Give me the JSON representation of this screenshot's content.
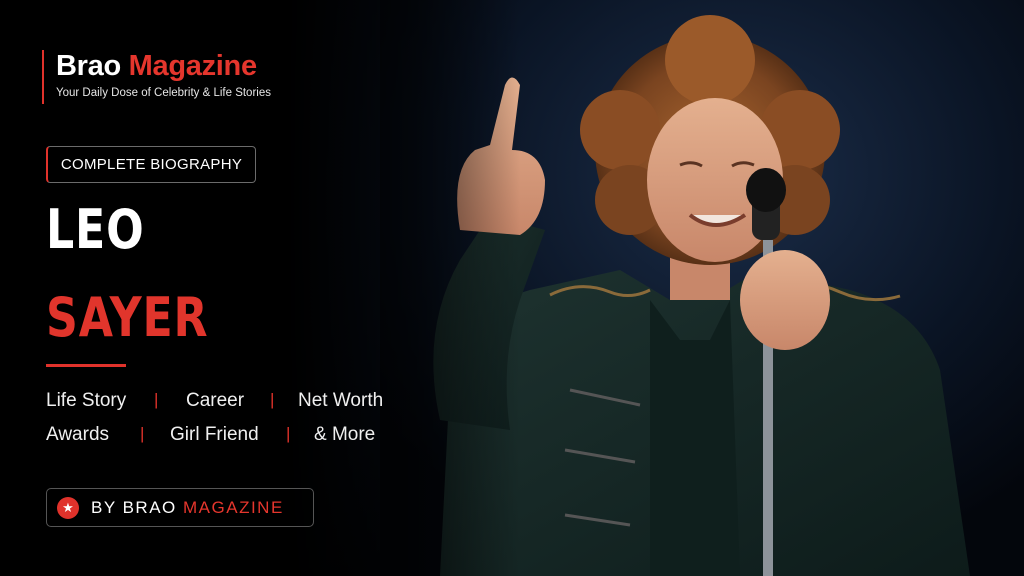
{
  "brand": {
    "name_white": "Brao",
    "name_red": "Magazine",
    "tagline": "Your Daily Dose of Celebrity & Life Stories"
  },
  "badge": "COMPLETE BIOGRAPHY",
  "person": {
    "first_name": "LEO",
    "last_name": "SAYER"
  },
  "topics": {
    "row1": [
      "Life Story",
      "Career",
      "Net Worth"
    ],
    "row2": [
      "Awards",
      "Girl Friend",
      "& More"
    ],
    "separator": "|"
  },
  "byline": {
    "prefix": "BY BRAO",
    "suffix": "MAGAZINE",
    "icon": "star-icon"
  },
  "colors": {
    "accent": "#e0322b",
    "background": "#000000"
  }
}
